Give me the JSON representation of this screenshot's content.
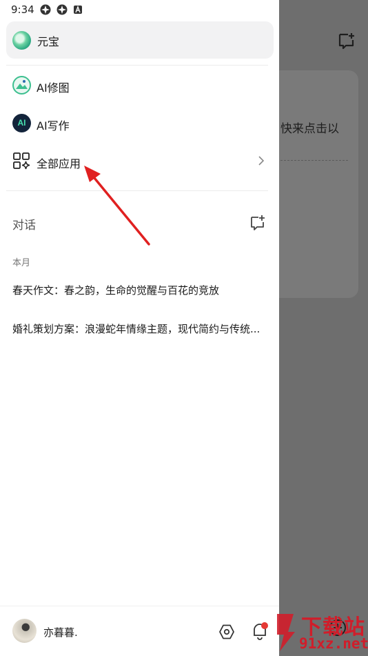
{
  "status_bar": {
    "time": "9:34"
  },
  "drawer": {
    "yuanbao_label": "元宝",
    "menu": [
      {
        "label": "AI修图",
        "icon": "ai-photo-edit-icon"
      },
      {
        "label": "AI写作",
        "icon": "ai-writing-icon",
        "icon_text": "AI"
      },
      {
        "label": "全部应用",
        "icon": "apps-grid-icon"
      }
    ],
    "section_title": "对话",
    "month_label": "本月",
    "conversations": [
      "春天作文：春之韵，生命的觉醒与百花的竞放",
      "婚礼策划方案：浪漫蛇年情缘主题，现代简约与传统..."
    ],
    "user_name": "亦暮暮."
  },
  "background": {
    "text": "快来点击以"
  },
  "watermark": {
    "big": "下载站",
    "small": "91xz.net"
  },
  "colors": {
    "accent_green": "#3cbf8f",
    "arrow_red": "#e02020",
    "watermark_red": "#d01d2a"
  }
}
